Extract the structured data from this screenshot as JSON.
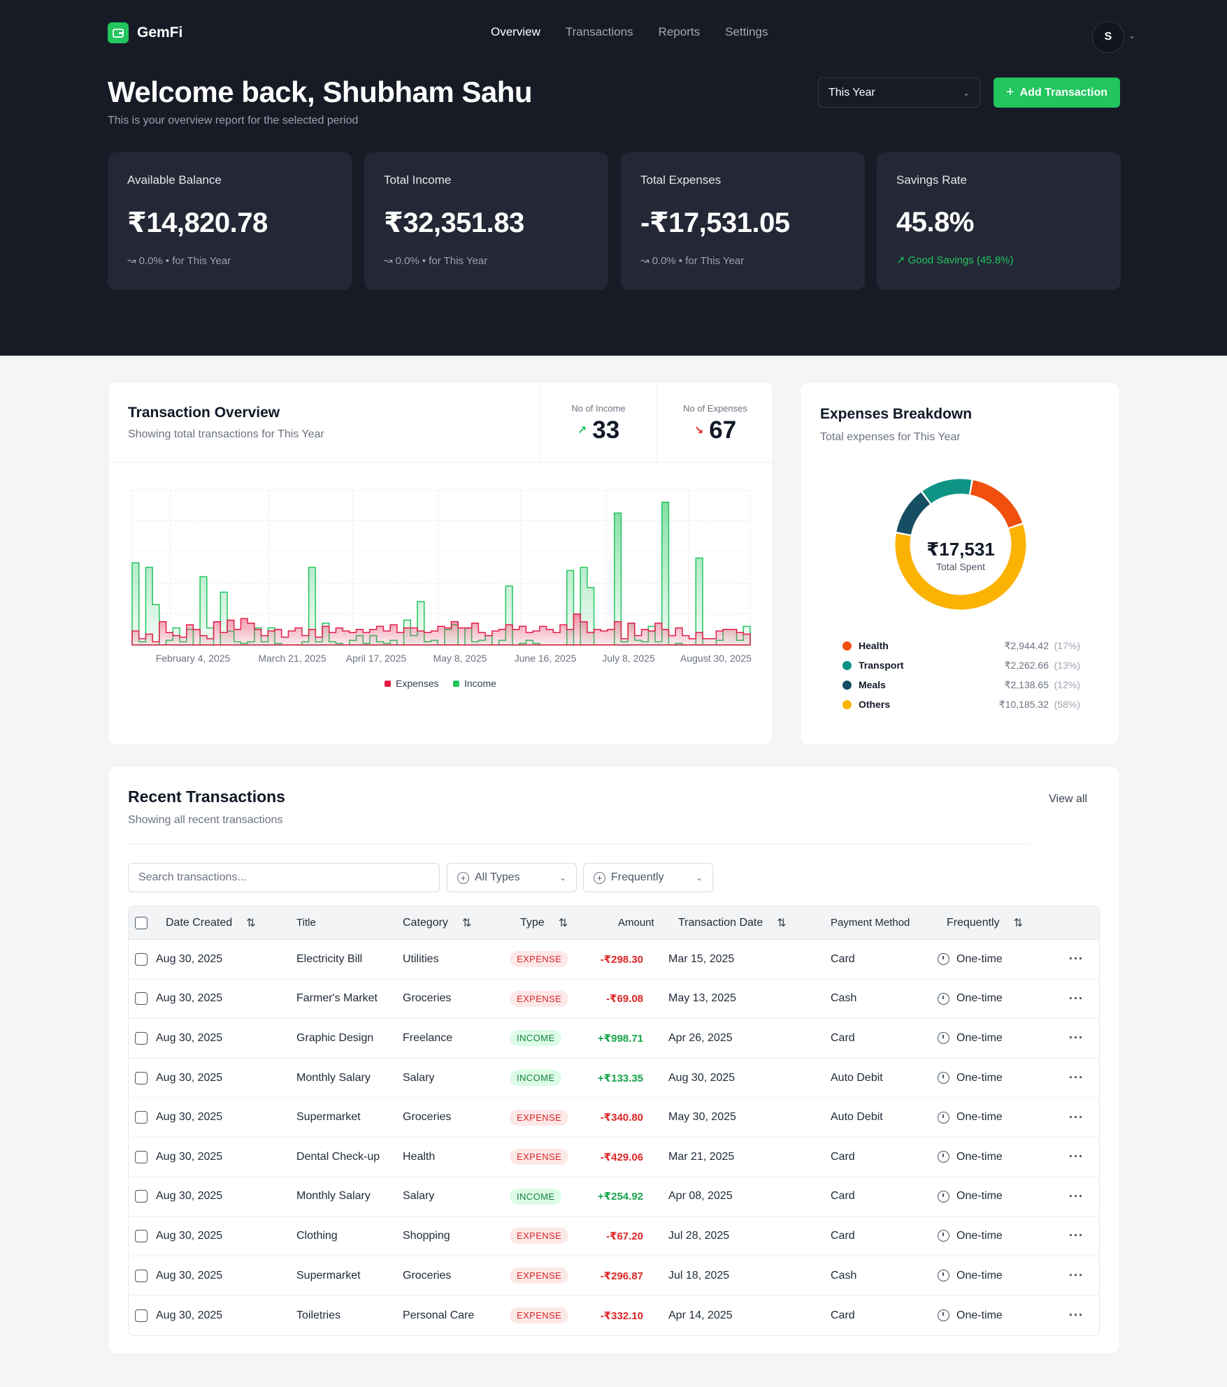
{
  "app": {
    "name": "GemFi",
    "nav": [
      "Overview",
      "Transactions",
      "Reports",
      "Settings"
    ],
    "active_nav": "Overview",
    "avatar_initial": "S"
  },
  "header": {
    "welcome": "Welcome back, Shubham Sahu",
    "subtitle": "This is your overview report for the selected period",
    "period": "This Year",
    "add_button": "Add Transaction"
  },
  "stats": [
    {
      "label": "Available Balance",
      "value": "₹14,820.78",
      "change": "0.0%",
      "suffix": "• for This Year"
    },
    {
      "label": "Total Income",
      "value": "₹32,351.83",
      "change": "0.0%",
      "suffix": "• for This Year"
    },
    {
      "label": "Total Expenses",
      "value": "-₹17,531.05",
      "change": "0.0%",
      "suffix": "• for This Year"
    },
    {
      "label": "Savings Rate",
      "value": "45.8%",
      "change": "Good Savings (45.8%)",
      "suffix": ""
    }
  ],
  "overview": {
    "title": "Transaction Overview",
    "subtitle": "Showing total transactions for This Year",
    "income_label": "No of Income",
    "income_count": "33",
    "expense_label": "No of Expenses",
    "expense_count": "67"
  },
  "chart_data": {
    "type": "area",
    "xtick_labels": [
      "February 4, 2025",
      "March 21, 2025",
      "April 17, 2025",
      "May 8, 2025",
      "June 16, 2025",
      "July 8, 2025",
      "August 30, 2025"
    ],
    "legend": [
      "Expenses",
      "Income"
    ],
    "legend_position": "bottom",
    "colors": {
      "Expenses": "#e11d48",
      "Income": "#22c55e"
    },
    "ylim": [
      0,
      1000
    ],
    "grid": true,
    "series": [
      {
        "name": "Income",
        "values": [
          530,
          20,
          500,
          260,
          0,
          30,
          110,
          20,
          100,
          0,
          440,
          110,
          0,
          340,
          90,
          20,
          10,
          20,
          110,
          20,
          110,
          10,
          0,
          0,
          0,
          20,
          500,
          20,
          140,
          20,
          10,
          0,
          30,
          60,
          10,
          60,
          20,
          10,
          30,
          0,
          160,
          60,
          280,
          20,
          30,
          0,
          100,
          130,
          0,
          110,
          20,
          30,
          60,
          0,
          30,
          380,
          0,
          10,
          30,
          10,
          0,
          0,
          0,
          0,
          480,
          0,
          500,
          370,
          0,
          0,
          0,
          850,
          20,
          140,
          30,
          20,
          120,
          20,
          920,
          0,
          10,
          0,
          0,
          560,
          0,
          0,
          30,
          100,
          100,
          30,
          120
        ]
      },
      {
        "name": "Expenses",
        "values": [
          90,
          40,
          70,
          20,
          150,
          80,
          60,
          50,
          130,
          100,
          60,
          40,
          150,
          80,
          160,
          100,
          170,
          140,
          100,
          60,
          90,
          100,
          50,
          90,
          110,
          60,
          100,
          50,
          120,
          80,
          110,
          90,
          80,
          100,
          80,
          100,
          120,
          90,
          130,
          80,
          110,
          110,
          90,
          80,
          90,
          120,
          110,
          150,
          110,
          110,
          140,
          80,
          60,
          90,
          100,
          130,
          100,
          120,
          80,
          90,
          120,
          100,
          80,
          130,
          100,
          200,
          150,
          80,
          100,
          90,
          100,
          150,
          40,
          140,
          60,
          100,
          90,
          140,
          100,
          60,
          110,
          60,
          40,
          80,
          40,
          40,
          90,
          100,
          100,
          80,
          70
        ]
      }
    ]
  },
  "breakdown": {
    "title": "Expenses Breakdown",
    "subtitle": "Total expenses for This Year",
    "total": "₹17,531",
    "total_label": "Total Spent",
    "items": [
      {
        "name": "Health",
        "amount": "₹2,944.42",
        "pct": "(17%)",
        "share": 17,
        "color": "#f04f0e"
      },
      {
        "name": "Transport",
        "amount": "₹2,262.66",
        "pct": "(13%)",
        "share": 13,
        "color": "#0e9384"
      },
      {
        "name": "Meals",
        "amount": "₹2,138.65",
        "pct": "(12%)",
        "share": 12,
        "color": "#164e63"
      },
      {
        "name": "Others",
        "amount": "₹10,185.32",
        "pct": "(58%)",
        "share": 58,
        "color": "#fbb200"
      }
    ]
  },
  "recent": {
    "title": "Recent Transactions",
    "subtitle": "Showing all recent transactions",
    "view_all": "View all",
    "search_placeholder": "Search transactions...",
    "filter_type": "All Types",
    "filter_freq": "Frequently",
    "columns": [
      "Date Created",
      "Title",
      "Category",
      "Type",
      "Amount",
      "Transaction Date",
      "Payment Method",
      "Frequently"
    ],
    "rows": [
      {
        "date": "Aug 30, 2025",
        "title": "Electricity Bill",
        "category": "Utilities",
        "type": "EXPENSE",
        "amount": "-₹298.30",
        "tdate": "Mar 15, 2025",
        "method": "Card",
        "freq": "One-time"
      },
      {
        "date": "Aug 30, 2025",
        "title": "Farmer's Market",
        "category": "Groceries",
        "type": "EXPENSE",
        "amount": "-₹69.08",
        "tdate": "May 13, 2025",
        "method": "Cash",
        "freq": "One-time"
      },
      {
        "date": "Aug 30, 2025",
        "title": "Graphic Design",
        "category": "Freelance",
        "type": "INCOME",
        "amount": "+₹998.71",
        "tdate": "Apr 26, 2025",
        "method": "Card",
        "freq": "One-time"
      },
      {
        "date": "Aug 30, 2025",
        "title": "Monthly Salary",
        "category": "Salary",
        "type": "INCOME",
        "amount": "+₹133.35",
        "tdate": "Aug 30, 2025",
        "method": "Auto Debit",
        "freq": "One-time"
      },
      {
        "date": "Aug 30, 2025",
        "title": "Supermarket",
        "category": "Groceries",
        "type": "EXPENSE",
        "amount": "-₹340.80",
        "tdate": "May 30, 2025",
        "method": "Auto Debit",
        "freq": "One-time"
      },
      {
        "date": "Aug 30, 2025",
        "title": "Dental Check-up",
        "category": "Health",
        "type": "EXPENSE",
        "amount": "-₹429.06",
        "tdate": "Mar 21, 2025",
        "method": "Card",
        "freq": "One-time"
      },
      {
        "date": "Aug 30, 2025",
        "title": "Monthly Salary",
        "category": "Salary",
        "type": "INCOME",
        "amount": "+₹254.92",
        "tdate": "Apr 08, 2025",
        "method": "Card",
        "freq": "One-time"
      },
      {
        "date": "Aug 30, 2025",
        "title": "Clothing",
        "category": "Shopping",
        "type": "EXPENSE",
        "amount": "-₹67.20",
        "tdate": "Jul 28, 2025",
        "method": "Card",
        "freq": "One-time"
      },
      {
        "date": "Aug 30, 2025",
        "title": "Supermarket",
        "category": "Groceries",
        "type": "EXPENSE",
        "amount": "-₹296.87",
        "tdate": "Jul 18, 2025",
        "method": "Cash",
        "freq": "One-time"
      },
      {
        "date": "Aug 30, 2025",
        "title": "Toiletries",
        "category": "Personal Care",
        "type": "EXPENSE",
        "amount": "-₹332.10",
        "tdate": "Apr 14, 2025",
        "method": "Card",
        "freq": "One-time"
      }
    ]
  }
}
